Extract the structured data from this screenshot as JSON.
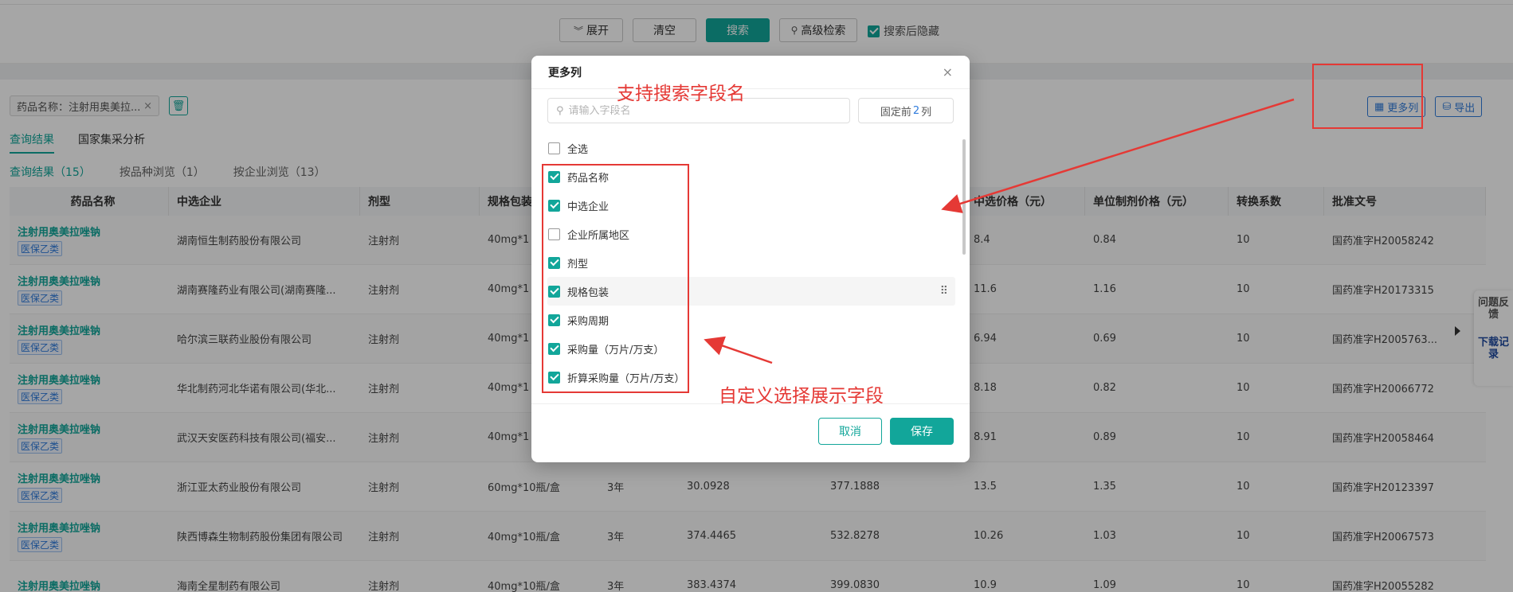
{
  "search_bar": {
    "expand_label": "展开",
    "clear_label": "清空",
    "search_label": "搜索",
    "advanced_label": "高级检索",
    "hide_after_search_label": "搜索后隐藏",
    "hide_after_search_checked": true
  },
  "filters": {
    "tag_text": "药品名称：注射用奥美拉...",
    "tag_close": "×"
  },
  "tabs": [
    "查询结果",
    "国家集采分析"
  ],
  "subtabs": [
    "查询结果（15）",
    "按品种浏览（1）",
    "按企业浏览（13）"
  ],
  "actions": {
    "more_columns": "更多列",
    "export": "导出"
  },
  "table": {
    "headers": [
      "药品名称",
      "中选企业",
      "剂型",
      "规格包装",
      "",
      "",
      "",
      "中选价格（元）",
      "单位制剂价格（元）",
      "转换系数",
      "批准文号"
    ],
    "rows": [
      {
        "name": "注射用奥美拉唑钠",
        "badge": "医保乙类",
        "company": "湖南恒生制药股份有限公司",
        "form": "注射剂",
        "spec": "40mg*1",
        "period": "",
        "amount": "",
        "amount2": "",
        "price": "8.4",
        "unit_price": "0.84",
        "factor": "10",
        "approval": "国药准字H20058242"
      },
      {
        "name": "注射用奥美拉唑钠",
        "badge": "医保乙类",
        "company": "湖南赛隆药业有限公司(湖南赛隆...",
        "form": "注射剂",
        "spec": "40mg*1",
        "period": "",
        "amount": "",
        "amount2": "",
        "price": "11.6",
        "unit_price": "1.16",
        "factor": "10",
        "approval": "国药准字H20173315"
      },
      {
        "name": "注射用奥美拉唑钠",
        "badge": "医保乙类",
        "company": "哈尔滨三联药业股份有限公司",
        "form": "注射剂",
        "spec": "40mg*1",
        "period": "",
        "amount": "",
        "amount2": "",
        "price": "6.94",
        "unit_price": "0.69",
        "factor": "10",
        "approval": "国药准字H2005763..."
      },
      {
        "name": "注射用奥美拉唑钠",
        "badge": "医保乙类",
        "company": "华北制药河北华诺有限公司(华北...",
        "form": "注射剂",
        "spec": "40mg*1",
        "period": "",
        "amount": "",
        "amount2": "",
        "price": "8.18",
        "unit_price": "0.82",
        "factor": "10",
        "approval": "国药准字H20066772"
      },
      {
        "name": "注射用奥美拉唑钠",
        "badge": "医保乙类",
        "company": "武汉天安医药科技有限公司(福安...",
        "form": "注射剂",
        "spec": "40mg*1",
        "period": "",
        "amount": "",
        "amount2": "",
        "price": "8.91",
        "unit_price": "0.89",
        "factor": "10",
        "approval": "国药准字H20058464"
      },
      {
        "name": "注射用奥美拉唑钠",
        "badge": "医保乙类",
        "company": "浙江亚太药业股份有限公司",
        "form": "注射剂",
        "spec": "60mg*10瓶/盒",
        "period": "3年",
        "amount": "30.0928",
        "amount2": "377.1888",
        "price": "13.5",
        "unit_price": "1.35",
        "factor": "10",
        "approval": "国药准字H20123397"
      },
      {
        "name": "注射用奥美拉唑钠",
        "badge": "医保乙类",
        "company": "陕西博森生物制药股份集团有限公司",
        "form": "注射剂",
        "spec": "40mg*10瓶/盒",
        "period": "3年",
        "amount": "374.4465",
        "amount2": "532.8278",
        "price": "10.26",
        "unit_price": "1.03",
        "factor": "10",
        "approval": "国药准字H20067573"
      },
      {
        "name": "注射用奥美拉唑钠",
        "badge": "",
        "company": "海南全星制药有限公司",
        "form": "注射剂",
        "spec": "40mg*10瓶/盒",
        "period": "3年",
        "amount": "383.4374",
        "amount2": "399.0830",
        "price": "10.9",
        "unit_price": "1.09",
        "factor": "10",
        "approval": "国药准字H20055282"
      }
    ]
  },
  "side_widget": {
    "feedback": "问题反馈",
    "downloads": "下载记录"
  },
  "modal": {
    "title": "更多列",
    "close": "×",
    "search_placeholder": "请输入字段名",
    "fix_prefix": "固定前",
    "fix_count": "2",
    "fix_suffix": "列",
    "select_all": "全选",
    "fields": [
      {
        "label": "药品名称",
        "checked": true
      },
      {
        "label": "中选企业",
        "checked": true
      },
      {
        "label": "企业所属地区",
        "checked": false
      },
      {
        "label": "剂型",
        "checked": true
      },
      {
        "label": "规格包装",
        "checked": true
      },
      {
        "label": "采购周期",
        "checked": true
      },
      {
        "label": "采购量（万片/万支）",
        "checked": true
      },
      {
        "label": "折算采购量（万片/万支）",
        "checked": true
      }
    ],
    "cancel": "取消",
    "save": "保存"
  },
  "annotations": {
    "search_note": "支持搜索字段名",
    "select_note": "自定义选择展示字段",
    "color": "#e53935"
  }
}
